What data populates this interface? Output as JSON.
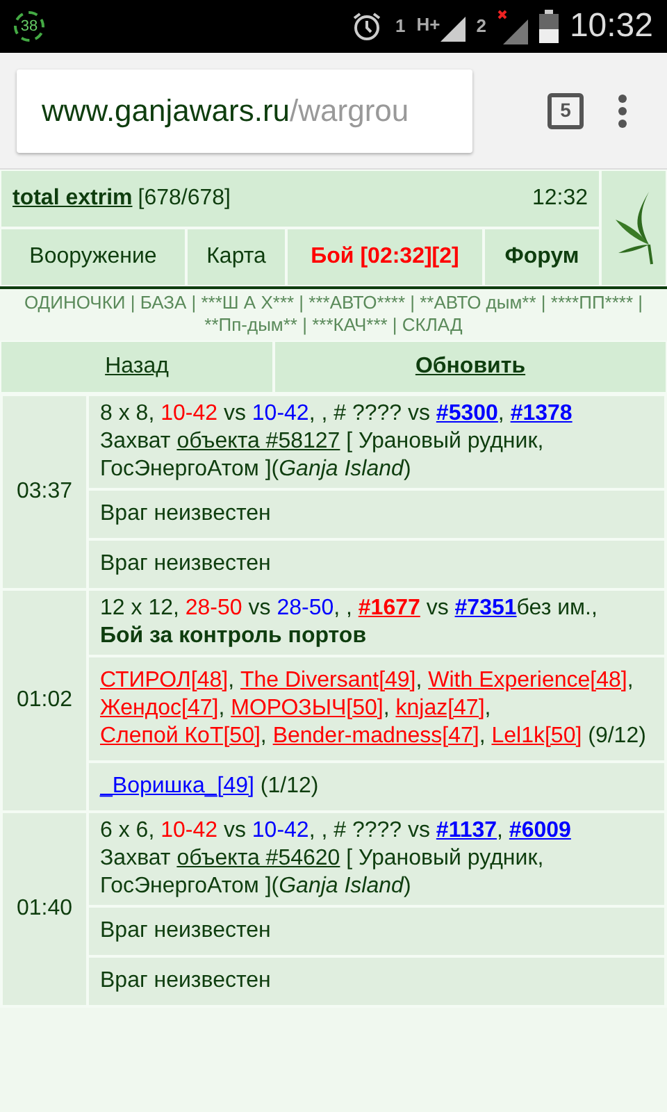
{
  "status_bar": {
    "badge": "38",
    "sim1": "1",
    "network1": "H+",
    "sim2": "2",
    "time": "10:32"
  },
  "browser": {
    "url_host": "www.ganjawars.ru",
    "url_path": "/wargrou",
    "tab_count": "5"
  },
  "header": {
    "user": "total extrim",
    "hp": "[678/678]",
    "time": "12:32"
  },
  "nav": [
    {
      "label": "Вооружение",
      "kind": "normal"
    },
    {
      "label": "Карта",
      "kind": "normal"
    },
    {
      "label": "Бой [02:32][2]",
      "kind": "alert"
    },
    {
      "label": "Форум",
      "kind": "bold"
    }
  ],
  "groups_text": "ОДИНОЧКИ | БАЗА | ***Ш А Х*** | ***АВТО**** | **АВТО дым** | ****ПП**** | **Пп-дым** | ***КАЧ*** | СКЛАД",
  "actions": [
    {
      "label": "Назад",
      "kind": "normal"
    },
    {
      "label": "Обновить",
      "kind": "bold"
    }
  ],
  "battles": [
    {
      "time": "03:37",
      "info": [
        [
          {
            "kind": "plain",
            "text": "8 x 8, "
          },
          {
            "kind": "red",
            "text": "10-42"
          },
          {
            "kind": "plain",
            "text": " vs "
          },
          {
            "kind": "blue",
            "text": "10-42"
          },
          {
            "kind": "plain",
            "text": ", , # ???? vs "
          },
          {
            "kind": "team-blue",
            "text": "#5300"
          },
          {
            "kind": "plain",
            "text": ", "
          },
          {
            "kind": "team-blue",
            "text": "#1378"
          }
        ],
        [
          {
            "kind": "plain",
            "text": "Захват "
          },
          {
            "kind": "object-link",
            "text": "объекта #58127"
          },
          {
            "kind": "plain",
            "text": " [ Урановый рудник, ГосЭнергоАтом ]("
          },
          {
            "kind": "italic",
            "text": "Ganja Island"
          },
          {
            "kind": "plain",
            "text": ")"
          }
        ]
      ],
      "sides": [
        [
          {
            "kind": "plain",
            "text": "Враг неизвестен"
          }
        ],
        [
          {
            "kind": "plain",
            "text": "Враг неизвестен"
          }
        ]
      ]
    },
    {
      "time": "01:02",
      "info": [
        [
          {
            "kind": "plain",
            "text": "12 x 12, "
          },
          {
            "kind": "red",
            "text": "28-50"
          },
          {
            "kind": "plain",
            "text": " vs "
          },
          {
            "kind": "blue",
            "text": "28-50"
          },
          {
            "kind": "plain",
            "text": ", , "
          },
          {
            "kind": "team-red",
            "text": "#1677"
          },
          {
            "kind": "plain",
            "text": " vs "
          },
          {
            "kind": "team-blue",
            "text": "#7351"
          },
          {
            "kind": "plain",
            "text": "без им.,"
          }
        ],
        [
          {
            "kind": "bold",
            "text": "Бой за контроль портов"
          }
        ]
      ],
      "sides": [
        [
          {
            "kind": "player-red",
            "text": "СТИРОЛ[48]"
          },
          {
            "kind": "plain",
            "text": ", "
          },
          {
            "kind": "player-red",
            "text": "The Diversant[49]"
          },
          {
            "kind": "plain",
            "text": ", "
          },
          {
            "kind": "player-red",
            "text": "With Experience[48]"
          },
          {
            "kind": "plain",
            "text": ", "
          },
          {
            "kind": "player-red",
            "text": "Жендос[47]"
          },
          {
            "kind": "plain",
            "text": ", "
          },
          {
            "kind": "player-red",
            "text": "МОРОЗЫЧ[50]"
          },
          {
            "kind": "plain",
            "text": ", "
          },
          {
            "kind": "player-red",
            "text": "knjaz[47]"
          },
          {
            "kind": "plain",
            "text": ", "
          },
          {
            "kind": "player-red",
            "text": "Слепой КоТ[50]"
          },
          {
            "kind": "plain",
            "text": ", "
          },
          {
            "kind": "player-red",
            "text": "Bender-madness[47]"
          },
          {
            "kind": "plain",
            "text": ", "
          },
          {
            "kind": "player-red",
            "text": "Lel1k[50]"
          },
          {
            "kind": "plain",
            "text": " (9/12)"
          }
        ],
        [
          {
            "kind": "player-blue",
            "text": "_Воришка_[49]"
          },
          {
            "kind": "plain",
            "text": " (1/12)"
          }
        ]
      ]
    },
    {
      "time": "01:40",
      "info": [
        [
          {
            "kind": "plain",
            "text": "6 x 6, "
          },
          {
            "kind": "red",
            "text": "10-42"
          },
          {
            "kind": "plain",
            "text": " vs "
          },
          {
            "kind": "blue",
            "text": "10-42"
          },
          {
            "kind": "plain",
            "text": ", , # ???? vs "
          },
          {
            "kind": "team-blue",
            "text": "#1137"
          },
          {
            "kind": "plain",
            "text": ", "
          },
          {
            "kind": "team-blue",
            "text": "#6009"
          }
        ],
        [
          {
            "kind": "plain",
            "text": "Захват "
          },
          {
            "kind": "object-link",
            "text": "объекта #54620"
          },
          {
            "kind": "plain",
            "text": " [ Урановый рудник, ГосЭнергоАтом ]("
          },
          {
            "kind": "italic",
            "text": "Ganja Island"
          },
          {
            "kind": "plain",
            "text": ")"
          }
        ]
      ],
      "sides": [
        [
          {
            "kind": "plain",
            "text": "Враг неизвестен"
          }
        ],
        [
          {
            "kind": "plain",
            "text": "Враг неизвестен"
          }
        ]
      ]
    }
  ]
}
